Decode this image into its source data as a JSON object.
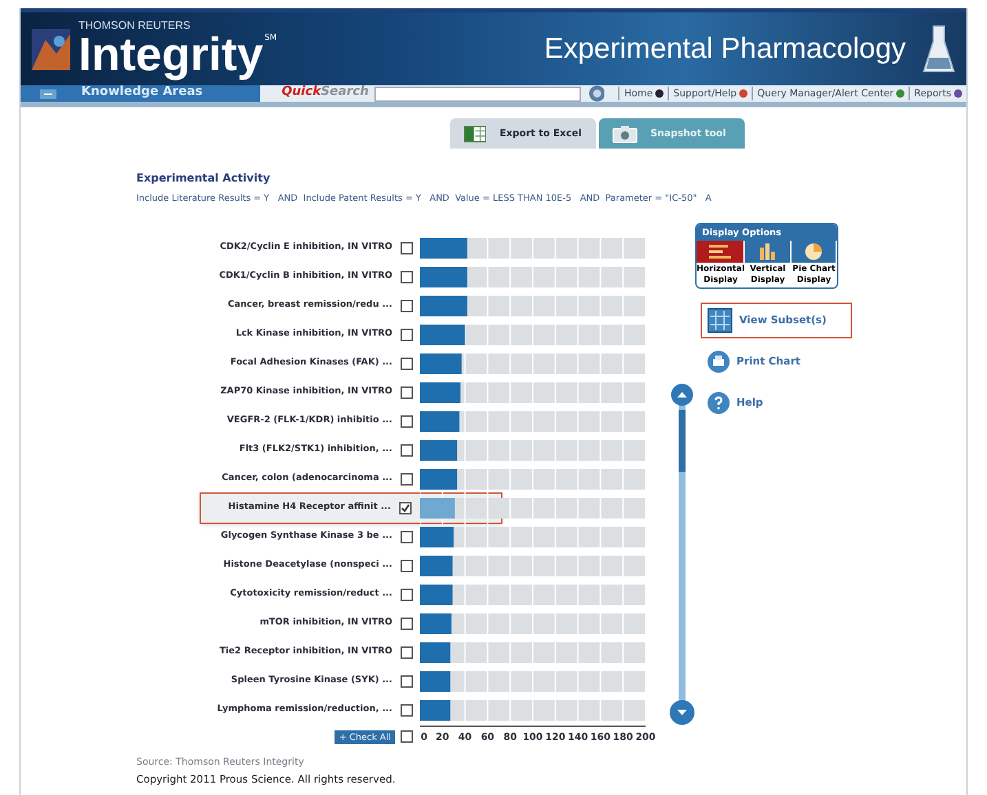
{
  "header": {
    "brand_small": "THOMSON REUTERS",
    "brand": "Integrity",
    "brand_mark": "SM",
    "module_title": "Experimental Pharmacology"
  },
  "navbar": {
    "knowledge_areas": "Knowledge Areas",
    "quick_search": {
      "part_1": "Quick",
      "part_2": "Search"
    },
    "links": [
      "Home",
      "Support/Help",
      "Query Manager/Alert Center",
      "Reports"
    ]
  },
  "toolbar": {
    "buttons": [
      {
        "label": "Export to Excel",
        "kind": "excel"
      },
      {
        "label": "Snapshot tool",
        "kind": "camera"
      }
    ]
  },
  "query": {
    "title": "Experimental Activity",
    "text": "Include Literature Results = Y   AND  Include Patent Results = Y   AND  Value = LESS THAN 10E-5   AND  Parameter = \"IC-50\"   A"
  },
  "rows": [
    {
      "checked": false,
      "selected": false
    },
    {
      "checked": false,
      "selected": false
    },
    {
      "checked": false,
      "selected": false
    },
    {
      "checked": false,
      "selected": false
    },
    {
      "checked": false,
      "selected": false
    },
    {
      "checked": false,
      "selected": false
    },
    {
      "checked": false,
      "selected": false
    },
    {
      "checked": false,
      "selected": false
    },
    {
      "checked": false,
      "selected": false
    },
    {
      "checked": true,
      "selected": true
    },
    {
      "checked": false,
      "selected": false
    },
    {
      "checked": false,
      "selected": false
    },
    {
      "checked": false,
      "selected": false
    },
    {
      "checked": false,
      "selected": false
    },
    {
      "checked": false,
      "selected": false
    },
    {
      "checked": false,
      "selected": false
    },
    {
      "checked": false,
      "selected": false
    }
  ],
  "chart_data": {
    "type": "bar",
    "orientation": "horizontal",
    "categories": [
      "CDK2/Cyclin E inhibition, IN VITRO",
      "CDK1/Cyclin B inhibition, IN VITRO",
      "Cancer, breast remission/redu ...",
      "Lck Kinase inhibition, IN VITRO",
      "Focal Adhesion Kinases (FAK)  ...",
      "ZAP70 Kinase inhibition, IN VITRO",
      "VEGFR-2 (FLK-1/KDR) inhibitio ...",
      "Flt3 (FLK2/STK1) inhibition,  ...",
      "Cancer, colon (adenocarcinoma ...",
      "Histamine H4 Receptor affinit ...",
      "Glycogen Synthase Kinase 3 be ...",
      "Histone Deacetylase (nonspeci ...",
      "Cytotoxicity remission/reduct ...",
      "mTOR inhibition, IN VITRO",
      "Tie2 Receptor inhibition, IN VITRO",
      "Spleen Tyrosine Kinase (SYK)  ...",
      "Lymphoma remission/reduction, ..."
    ],
    "values": [
      42,
      42,
      42,
      40,
      37,
      36,
      35,
      33,
      33,
      31,
      30,
      29,
      29,
      28,
      27,
      27,
      27
    ],
    "xlim": [
      0,
      200
    ],
    "grid": true,
    "xticks": [
      0,
      20,
      40,
      60,
      80,
      100,
      120,
      140,
      160,
      180,
      200
    ]
  },
  "check_all": {
    "label": "+ Check All",
    "checked": false
  },
  "display_options": {
    "title": "Display Options",
    "options": [
      {
        "label": "Horizontal Display",
        "kind": "horizontal",
        "selected": true
      },
      {
        "label": "Vertical Display",
        "kind": "vertical",
        "selected": false
      },
      {
        "label": "Pie Chart Display",
        "kind": "pie",
        "selected": false
      }
    ]
  },
  "actions": [
    {
      "label": "View Subset(s)",
      "kind": "subset",
      "highlighted": true
    },
    {
      "label": "Print Chart",
      "kind": "print",
      "highlighted": false
    },
    {
      "label": "Help",
      "kind": "help",
      "highlighted": false
    }
  ],
  "footer": {
    "source": "Source: Thomson Reuters Integrity",
    "copyright": "Copyright 2011 Prous Science. All rights reserved."
  }
}
